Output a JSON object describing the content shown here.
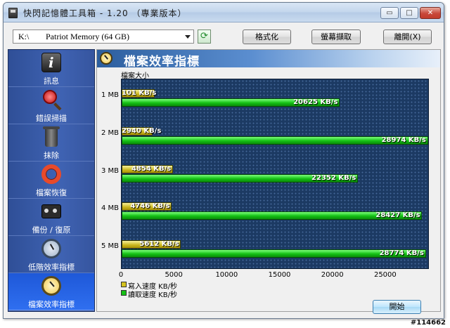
{
  "window": {
    "title": "快閃記憶體工具箱 - 1.20 （專業版本）",
    "controls": {
      "minimize": "▭",
      "maximize": "□",
      "close": "✕"
    }
  },
  "toolbar": {
    "drive_letter": "K:\\",
    "drive_name": "Patriot Memory (64 GB)",
    "refresh_icon": "refresh-icon",
    "format_label": "格式化",
    "capture_label": "螢幕擷取",
    "exit_label": "離開(X)"
  },
  "sidebar": {
    "items": [
      {
        "label": "訊息",
        "icon": "info-icon"
      },
      {
        "label": "錯誤掃描",
        "icon": "magnifier-icon"
      },
      {
        "label": "抹除",
        "icon": "trash-icon"
      },
      {
        "label": "檔案恢復",
        "icon": "lifebuoy-icon"
      },
      {
        "label": "備份 / 復原",
        "icon": "tape-icon"
      },
      {
        "label": "低階效率指標",
        "icon": "stopwatch-icon"
      },
      {
        "label": "檔案效率指標",
        "icon": "stopwatch-icon",
        "active": true
      }
    ]
  },
  "panel": {
    "title": "檔案效率指標",
    "size_axis_label": "檔案大小",
    "start_label": "開始"
  },
  "chart_data": {
    "type": "bar",
    "orientation": "horizontal",
    "categories": [
      "1 MB",
      "2 MB",
      "3 MB",
      "4 MB",
      "5 MB"
    ],
    "series": [
      {
        "name": "寫入速度 KB/秒",
        "color": "#d4c21e",
        "values": [
          3101,
          2940,
          4854,
          4746,
          5612
        ],
        "labels": [
          "101 KB/s",
          "2940 KB/s",
          "4854 KB/s",
          "4746 KB/s",
          "5612 KB/s"
        ]
      },
      {
        "name": "讀取速度 KB/秒",
        "color": "#14c014",
        "values": [
          20625,
          28974,
          22352,
          28427,
          28774
        ],
        "labels": [
          "20625 KB/s",
          "28974 KB/s",
          "22352 KB/s",
          "28427 KB/s",
          "28774 KB/s"
        ]
      }
    ],
    "xlim": [
      0,
      29000
    ],
    "xticks": [
      0,
      5000,
      10000,
      15000,
      20000,
      25000
    ],
    "xtick_labels": [
      "0",
      "5000",
      "10000",
      "15000",
      "20000",
      "25000"
    ],
    "legend": "bottom-left"
  },
  "watermark": "#114662"
}
